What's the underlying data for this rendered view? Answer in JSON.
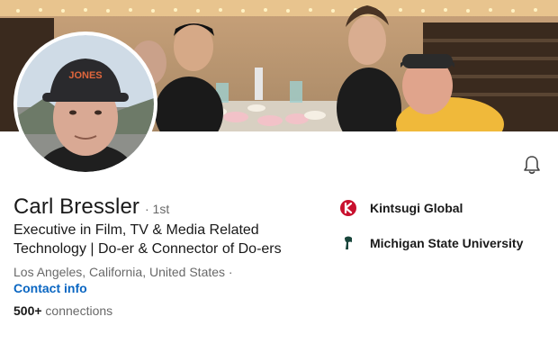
{
  "profile": {
    "name": "Carl Bressler",
    "degree": "· 1st",
    "headline": "Executive in Film, TV & Media Related Technology | Do-er & Connector of Do-ers",
    "location": "Los Angeles, California, United States ·",
    "contact_label": "Contact info",
    "connections_count": "500+",
    "connections_label": " connections"
  },
  "experience": {
    "company": "Kintsugi Global",
    "company_icon": "kintsugi-logo-icon",
    "school": "Michigan State University",
    "school_icon": "msu-spartan-logo-icon"
  },
  "actions": {
    "bell_icon": "bell-icon"
  },
  "colors": {
    "link": "#0a66c2",
    "kintsugi_red": "#c8102e",
    "msu_green": "#18453b"
  }
}
